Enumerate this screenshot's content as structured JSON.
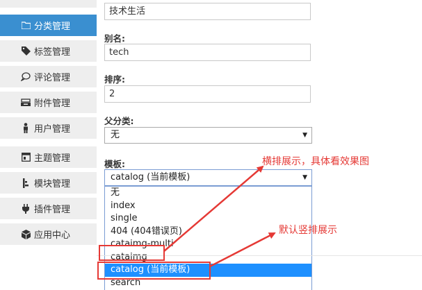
{
  "sidebar": {
    "items": [
      {
        "label": "",
        "icon": "top-item-icon"
      },
      {
        "label": "分类管理",
        "icon": "folder-icon",
        "active": true
      },
      {
        "label": "标签管理",
        "icon": "tag-icon"
      },
      {
        "label": "评论管理",
        "icon": "comment-icon"
      },
      {
        "label": "附件管理",
        "icon": "attachment-icon"
      },
      {
        "label": "用户管理",
        "icon": "user-icon"
      },
      {
        "label": "主题管理",
        "icon": "theme-icon"
      },
      {
        "label": "模块管理",
        "icon": "module-icon"
      },
      {
        "label": "插件管理",
        "icon": "plugin-icon"
      },
      {
        "label": "应用中心",
        "icon": "cube-icon"
      }
    ],
    "active_color": "#3a8fd0"
  },
  "form": {
    "name_value": "技术生活",
    "alias_label": "别名:",
    "alias_value": "tech",
    "order_label": "排序:",
    "order_value": "2",
    "parent_label": "父分类:",
    "parent_value": "无",
    "template_label": "模板:",
    "template_value": "catalog (当前模板)",
    "template_options": [
      "无",
      "index",
      "single",
      "404 (404错误页)",
      "cataimg-multi",
      "cataimg",
      "catalog (当前模板)",
      "search"
    ],
    "selected_option_index": 6,
    "selected_color": "#1e90ff"
  },
  "annotations": {
    "horizontal_note": "横排展示，具体看效果图",
    "vertical_note": "默认竖排展示",
    "color": "#e53935"
  }
}
